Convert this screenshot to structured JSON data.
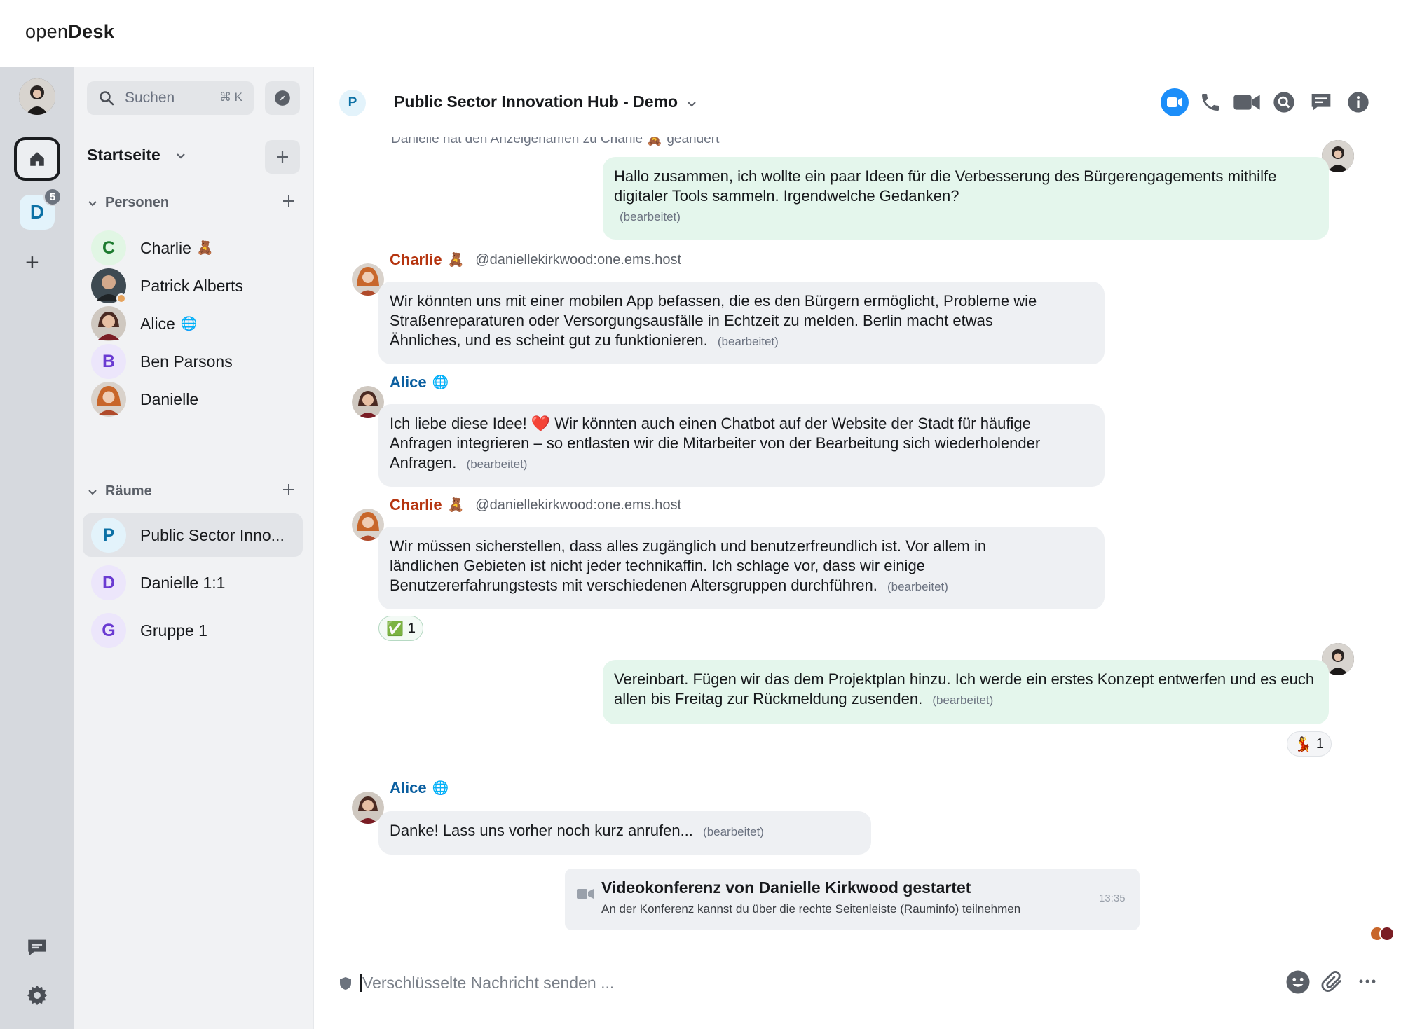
{
  "brand": {
    "prefix": "open",
    "name": "Desk"
  },
  "rail": {
    "space_initial": "D",
    "space_badge": "5",
    "add_label": "+"
  },
  "roomlist": {
    "search_label": "Suchen",
    "search_shortcut": "⌘ K",
    "home_title": "Startseite",
    "sections": {
      "people": "Personen",
      "rooms": "Räume"
    },
    "people": [
      {
        "initial": "C",
        "label": "Charlie",
        "emoji": "🧸",
        "avatar_color": "#e1f6e4",
        "text_color": "#1c7a2e"
      },
      {
        "initial": "",
        "label": "Patrick Alberts",
        "emoji": ""
      },
      {
        "initial": "",
        "label": "Alice",
        "emoji": "🌐"
      },
      {
        "initial": "B",
        "label": "Ben Parsons",
        "emoji": "",
        "avatar_color": "#ece6fb",
        "text_color": "#6a3bd2"
      },
      {
        "initial": "",
        "label": "Danielle",
        "emoji": ""
      }
    ],
    "rooms": [
      {
        "initial": "P",
        "label": "Public Sector Inno...",
        "avatar_color": "#e3f3fb",
        "text_color": "#0b70a5"
      },
      {
        "initial": "D",
        "label": "Danielle 1:1",
        "avatar_color": "#ece6fb",
        "text_color": "#6a3bd2"
      },
      {
        "initial": "G",
        "label": "Gruppe 1",
        "avatar_color": "#ece6fb",
        "text_color": "#6a3bd2"
      }
    ]
  },
  "header": {
    "room_initial": "P",
    "room_name": "Public Sector Innovation Hub - Demo"
  },
  "timeline": {
    "notice": "Danielle hat den Anzeigenamen zu Charlie 🧸 geändert",
    "edited_label": "(bearbeitet)",
    "messages": [
      {
        "own": true,
        "text": "Hallo zusammen, ich wollte ein paar Ideen für die Verbesserung des Bürgerengagements mithilfe digitaler Tools sammeln. Irgendwelche Gedanken?"
      },
      {
        "sender": "Charlie",
        "sender_emoji": "🧸",
        "sender_id": "@daniellekirkwood:one.ems.host",
        "sender_color": "#b5340f",
        "text": "Wir könnten uns mit einer mobilen App befassen, die es den Bürgern ermöglicht, Probleme wie Straßenreparaturen oder Versorgungsausfälle in Echtzeit zu melden. Berlin macht etwas Ähnliches, und es scheint gut zu funktionieren."
      },
      {
        "sender": "Alice",
        "sender_emoji": "🌐",
        "sender_id": "",
        "sender_color": "#0b5fa0",
        "text": "Ich liebe diese Idee! ❤️ Wir könnten auch einen Chatbot auf der Website der Stadt für häufige Anfragen integrieren – so entlasten wir die Mitarbeiter von der Bearbeitung sich wiederholender Anfragen."
      },
      {
        "sender": "Charlie",
        "sender_emoji": "🧸",
        "sender_id": "@daniellekirkwood:one.ems.host",
        "sender_color": "#b5340f",
        "text": "Wir müssen sicherstellen, dass alles zugänglich und benutzerfreundlich ist. Vor allem in ländlichen Gebieten ist nicht jeder technikaffin. Ich schlage vor, dass wir einige Benutzererfahrungstests mit verschiedenen Altersgruppen durchführen.",
        "reaction": {
          "emoji": "✅",
          "count": "1"
        }
      },
      {
        "own": true,
        "text": "Vereinbart. Fügen wir das dem Projektplan hinzu. Ich werde ein erstes Konzept entwerfen und es euch allen bis Freitag zur Rückmeldung zusenden.",
        "reaction": {
          "emoji": "💃",
          "count": "1"
        }
      },
      {
        "sender": "Alice",
        "sender_emoji": "🌐",
        "sender_id": "",
        "sender_color": "#0b5fa0",
        "text": "Danke! Lass uns vorher noch kurz anrufen..."
      }
    ],
    "call": {
      "title": "Videokonferenz von Danielle Kirkwood gestartet",
      "subtitle": "An der Konferenz kannst du über die rechte Seitenleiste (Rauminfo) teilnehmen",
      "time": "13:35"
    }
  },
  "composer": {
    "placeholder": "Verschlüsselte Nachricht senden ..."
  },
  "icons": [
    "home-icon",
    "search-icon",
    "compass-icon",
    "chevron-down-icon",
    "plus-icon",
    "video-call-icon",
    "phone-icon",
    "camera-icon",
    "room-search-icon",
    "threads-icon",
    "info-icon",
    "emoji-icon",
    "attachment-icon",
    "more-icon",
    "settings-icon",
    "shield-icon"
  ],
  "colors": {
    "own_bubble": "#e4f6ec",
    "other_bubble": "#eef0f3",
    "accent": "#0dbd8b",
    "call_blue": "#1c8ef9"
  }
}
